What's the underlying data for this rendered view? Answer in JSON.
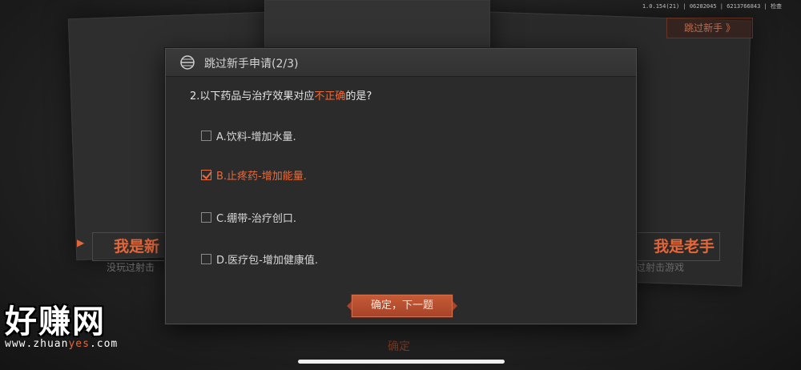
{
  "version": "1.0.154(21) | 06282045 | 6213766843 | 检查",
  "background": {
    "skip_label": "跳过新手 》",
    "left_option": "我是新",
    "right_option": "我是老手",
    "left_sub": "没玩过射击",
    "right_sub": "过射击游戏",
    "confirm": "确定"
  },
  "dialog": {
    "title": "跳过新手申请(2/3)",
    "question_prefix": "2.以下药品与治疗效果对应",
    "question_highlight": "不正确",
    "question_suffix": "的是?",
    "options": [
      {
        "label": "A.饮料-增加水量.",
        "checked": false
      },
      {
        "label": "B.止疼药-增加能量.",
        "checked": true
      },
      {
        "label": "C.绷带-治疗创口.",
        "checked": false
      },
      {
        "label": "D.医疗包-增加健康值.",
        "checked": false
      }
    ],
    "confirm_label": "确定，下一题"
  },
  "watermark": {
    "name": "好赚网",
    "url_a": "www.zhuan",
    "url_b": "yes",
    "url_c": ".com"
  },
  "colors": {
    "accent": "#e86b3a",
    "button": "#b54e2f"
  }
}
